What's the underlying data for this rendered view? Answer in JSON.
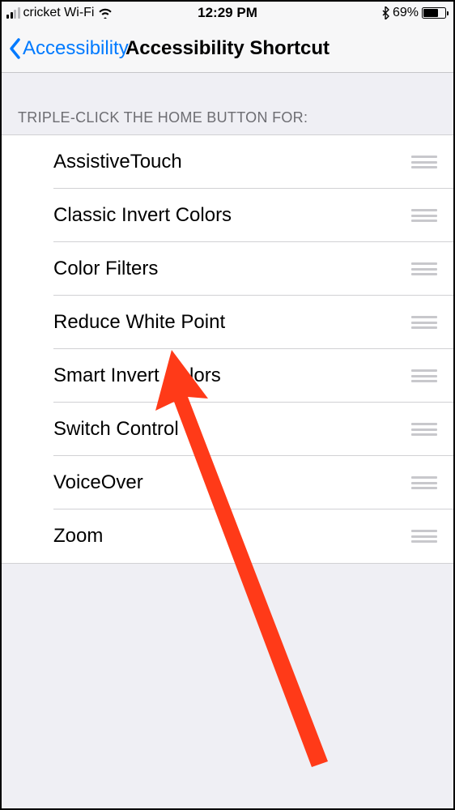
{
  "status_bar": {
    "carrier": "cricket Wi-Fi",
    "time": "12:29 PM",
    "battery_percent": "69%"
  },
  "nav": {
    "back_label": "Accessibility",
    "title": "Accessibility Shortcut"
  },
  "section_header": "TRIPLE-CLICK THE HOME BUTTON FOR:",
  "options": [
    {
      "label": "AssistiveTouch"
    },
    {
      "label": "Classic Invert Colors"
    },
    {
      "label": "Color Filters"
    },
    {
      "label": "Reduce White Point"
    },
    {
      "label": "Smart Invert Colors"
    },
    {
      "label": "Switch Control"
    },
    {
      "label": "VoiceOver"
    },
    {
      "label": "Zoom"
    }
  ],
  "annotation": {
    "target": "Reduce White Point",
    "color": "#ff3a18"
  }
}
